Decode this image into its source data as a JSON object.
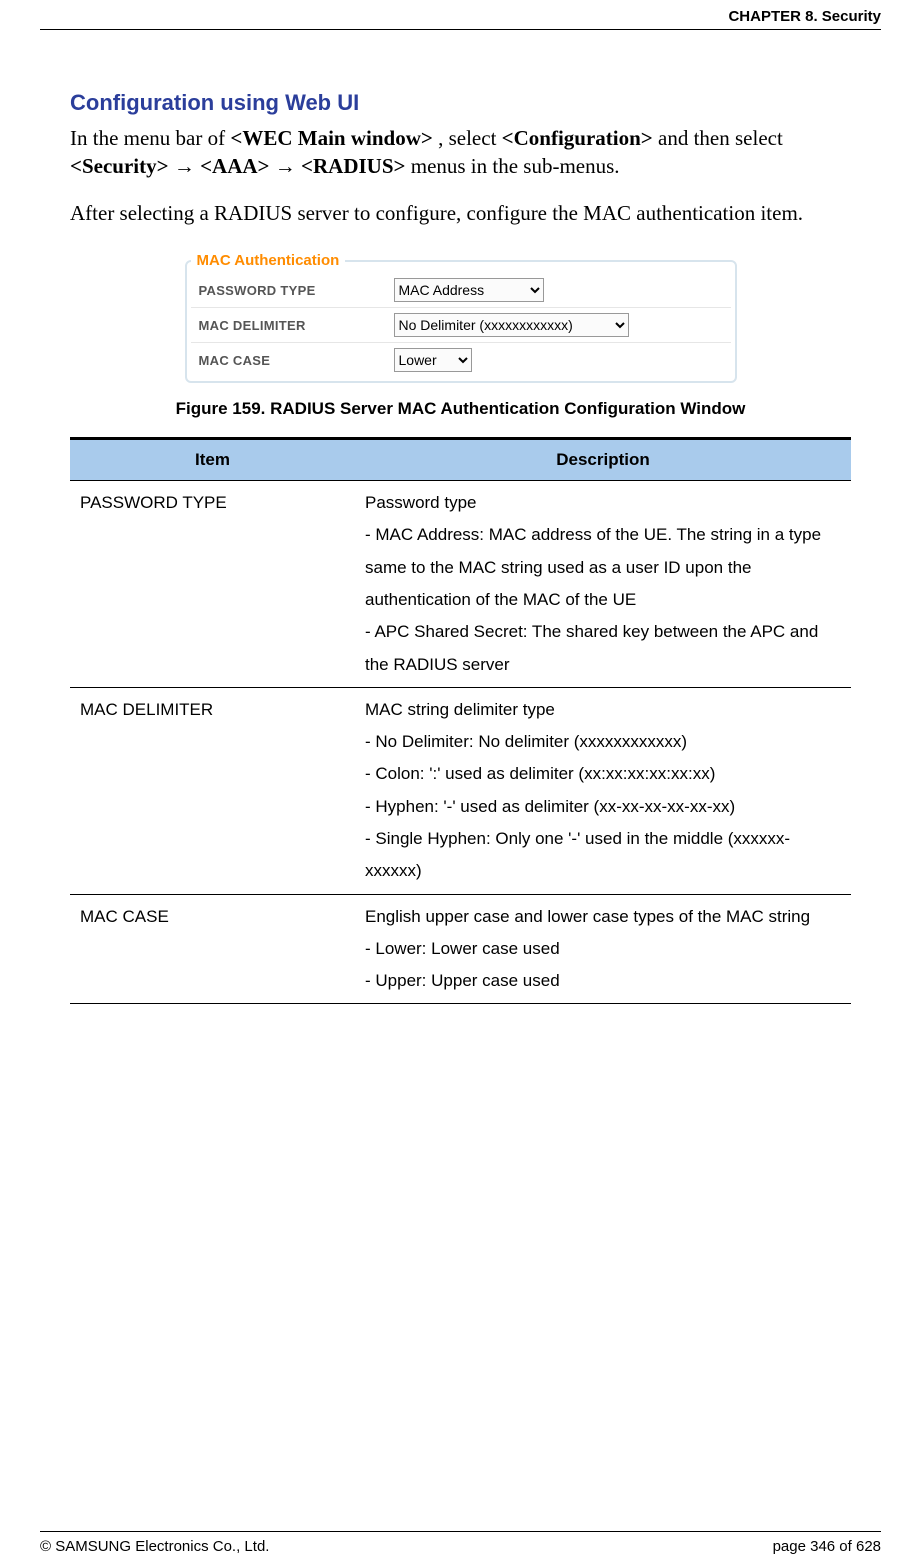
{
  "header": {
    "chapter": "CHAPTER 8. Security"
  },
  "section": {
    "heading": "Configuration using Web UI",
    "para1_prefix": "In the menu bar of ",
    "para1_bold1": "<WEC Main window>",
    "para1_mid1": ", select ",
    "para1_bold2": "<Configuration>",
    "para1_mid2": " and then select ",
    "para1_bold3": "<Security>",
    "para1_arrow1": " → ",
    "para1_bold4": "<AAA>",
    "para1_arrow2": " → ",
    "para1_bold5": "<RADIUS>",
    "para1_tail": " menus in the sub-menus.",
    "para2": "After selecting a RADIUS server to configure, configure the MAC authentication item."
  },
  "figure": {
    "legend": "MAC Authentication",
    "rows": [
      {
        "label": "PASSWORD TYPE",
        "value": "MAC Address"
      },
      {
        "label": "MAC DELIMITER",
        "value": "No Delimiter (xxxxxxxxxxxx)"
      },
      {
        "label": "MAC CASE",
        "value": "Lower"
      }
    ],
    "caption": "Figure 159. RADIUS Server MAC Authentication Configuration Window"
  },
  "table": {
    "headers": {
      "item": "Item",
      "desc": "Description"
    },
    "rows": [
      {
        "item": "PASSWORD TYPE",
        "desc": "Password type\n- MAC Address: MAC address of the UE. The string in a type same to the MAC string used as a user ID upon the authentication of the MAC of the UE\n- APC Shared Secret: The shared key between the APC and the RADIUS server"
      },
      {
        "item": "MAC DELIMITER",
        "desc": "MAC string delimiter type\n- No Delimiter: No delimiter (xxxxxxxxxxxx)\n- Colon: ':' used as delimiter (xx:xx:xx:xx:xx:xx)\n- Hyphen: '-' used as delimiter (xx-xx-xx-xx-xx-xx)\n- Single Hyphen: Only one '-' used in the middle (xxxxxx-xxxxxx)"
      },
      {
        "item": "MAC CASE",
        "desc": "English upper case and lower case types of the MAC string\n- Lower: Lower case used\n- Upper: Upper case used"
      }
    ]
  },
  "footer": {
    "copyright": "© SAMSUNG Electronics Co., Ltd.",
    "page": "page 346 of 628"
  }
}
